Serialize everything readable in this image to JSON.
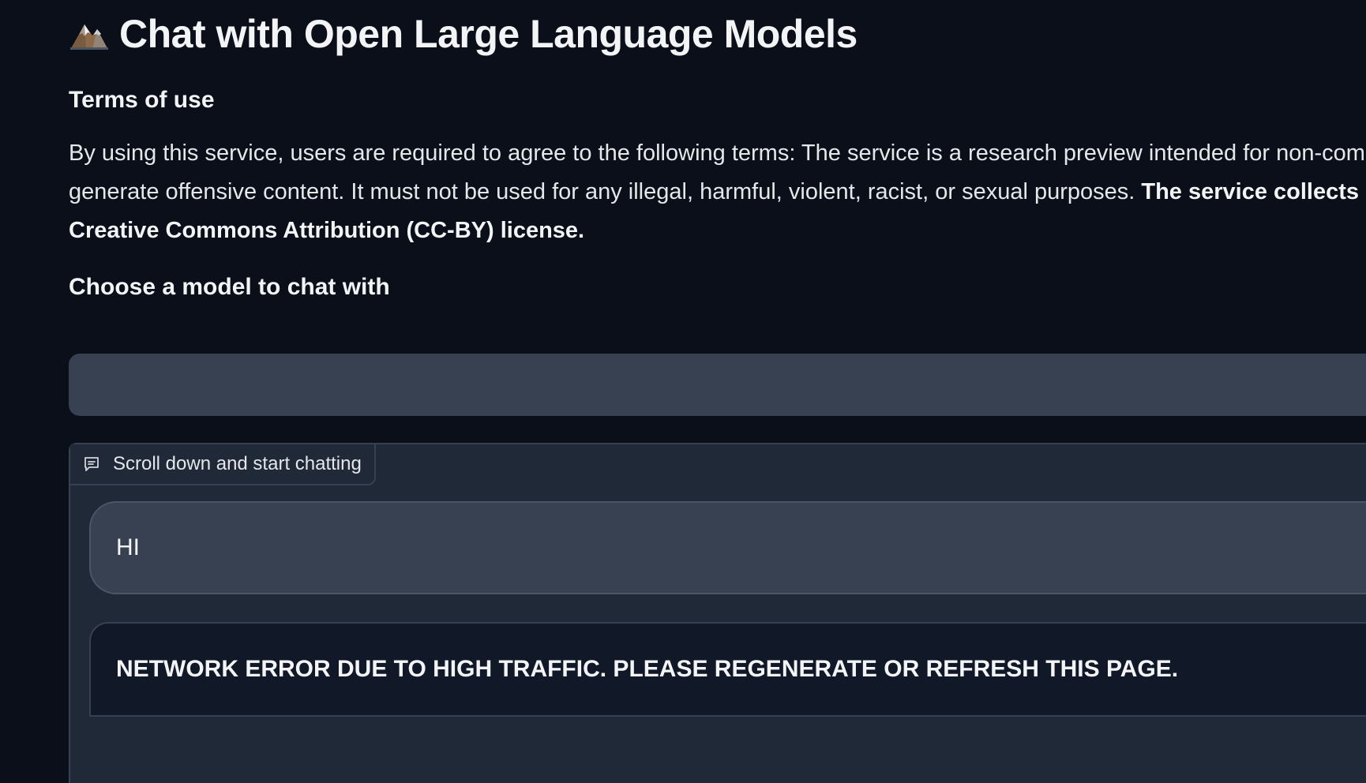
{
  "header": {
    "title": "Chat with Open Large Language Models",
    "icon": "mountain-icon"
  },
  "terms": {
    "heading": "Terms of use",
    "line1": "By using this service, users are required to agree to the following terms: The service is a research preview intended for non-commer",
    "line2_normal": "generate offensive content. It must not be used for any illegal, harmful, violent, racist, or sexual purposes. ",
    "line2_bold": "The service collects user",
    "line3_bold": "Creative Commons Attribution (CC-BY) license."
  },
  "model_picker": {
    "heading": "Choose a model to chat with",
    "selected": ""
  },
  "chat": {
    "label": "Scroll down and start chatting",
    "label_icon": "chat-bubble-icon",
    "messages": [
      {
        "role": "user",
        "text": "HI"
      },
      {
        "role": "bot",
        "text": "NETWORK ERROR DUE TO HIGH TRAFFIC. PLEASE REGENERATE OR REFRESH THIS PAGE."
      }
    ]
  },
  "colors": {
    "background": "#0b0f19",
    "panel": "#1f2937",
    "user_bubble": "#374151",
    "bot_bubble": "#111827"
  }
}
